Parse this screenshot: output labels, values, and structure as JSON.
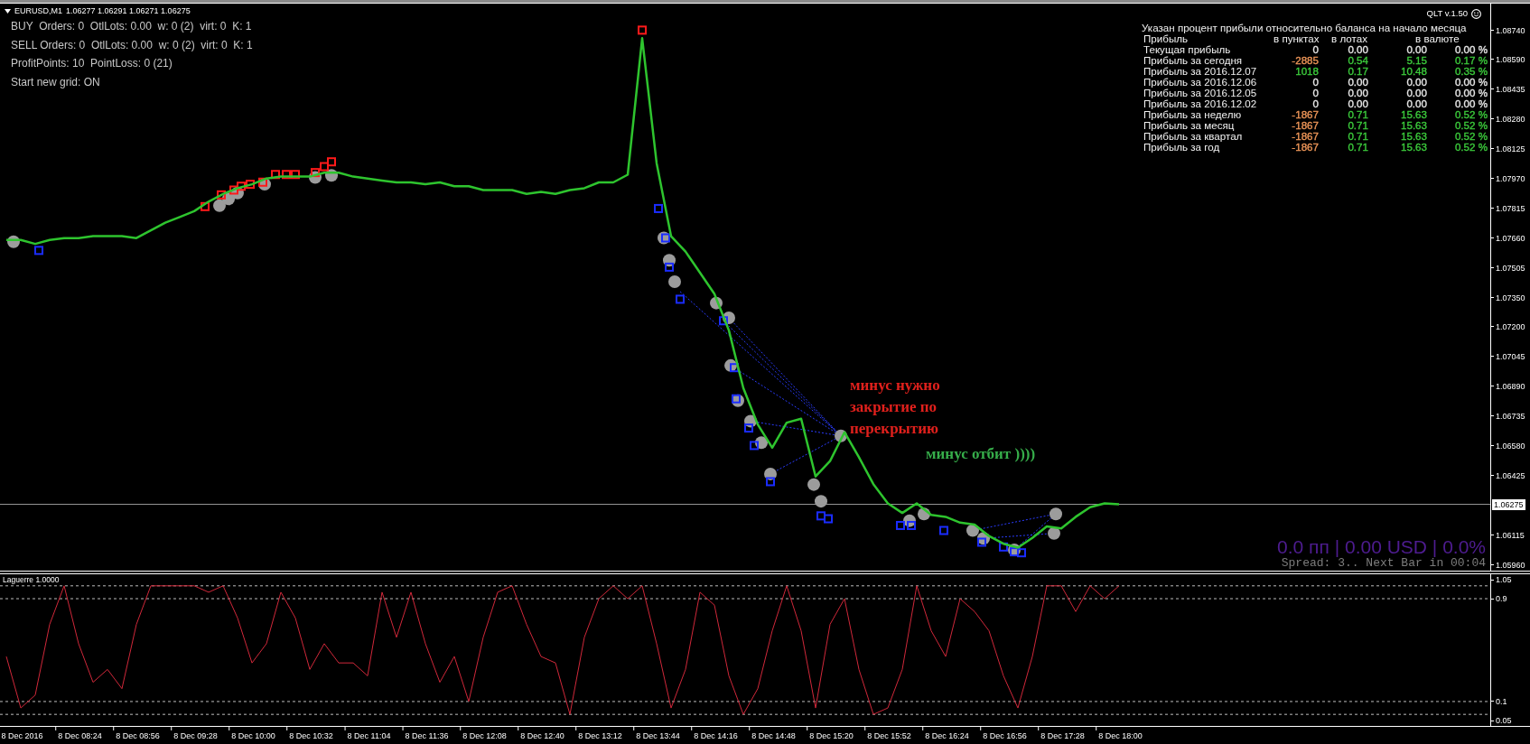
{
  "header": {
    "quote": "1.06277 1.06291 1.06271 1.06275"
  },
  "status_lines": [
    "BUY  Orders: 0  OtlLots: 0.00  w: 0 (2)  virt: 0  K: 1",
    "SELL Orders: 0  OtlLots: 0.00  w: 0 (2)  virt: 0  K: 1",
    "ProfitPoints: 10  PointLoss: 0 (21)",
    "Start new grid: ON"
  ],
  "version": {
    "label": "QLT v.1.50"
  },
  "profit_table": {
    "title": "Указан процент прибыли относительно баланса на начало месяца",
    "label_header": "Прибыль",
    "columns": [
      "в пунктах",
      "в лотах",
      "в валюте"
    ],
    "rows": [
      {
        "label": "Текущая прибыль",
        "cells": [
          {
            "text": "0",
            "color": "#e6e6e6"
          },
          {
            "text": "0.00",
            "color": "#e6e6e6"
          },
          {
            "text": "0.00",
            "color": "#e6e6e6"
          },
          {
            "text": "0.00 %",
            "color": "#e6e6e6"
          }
        ]
      },
      {
        "label": "Прибыль за сегодня",
        "cells": [
          {
            "text": "-2885",
            "color": "#ee9658"
          },
          {
            "text": "0.54",
            "color": "#3ccc3c"
          },
          {
            "text": "5.15",
            "color": "#3ccc3c"
          },
          {
            "text": "0.17 %",
            "color": "#3ccc3c"
          }
        ]
      },
      {
        "label": "Прибыль за 2016.12.07",
        "cells": [
          {
            "text": "1018",
            "color": "#3ccc3c"
          },
          {
            "text": "0.17",
            "color": "#3ccc3c"
          },
          {
            "text": "10.48",
            "color": "#3ccc3c"
          },
          {
            "text": "0.35 %",
            "color": "#3ccc3c"
          }
        ]
      },
      {
        "label": "Прибыль за 2016.12.06",
        "cells": [
          {
            "text": "0",
            "color": "#e6e6e6"
          },
          {
            "text": "0.00",
            "color": "#e6e6e6"
          },
          {
            "text": "0.00",
            "color": "#e6e6e6"
          },
          {
            "text": "0.00 %",
            "color": "#e6e6e6"
          }
        ]
      },
      {
        "label": "Прибыль за 2016.12.05",
        "cells": [
          {
            "text": "0",
            "color": "#e6e6e6"
          },
          {
            "text": "0.00",
            "color": "#e6e6e6"
          },
          {
            "text": "0.00",
            "color": "#e6e6e6"
          },
          {
            "text": "0.00 %",
            "color": "#e6e6e6"
          }
        ]
      },
      {
        "label": "Прибыль за 2016.12.02",
        "cells": [
          {
            "text": "0",
            "color": "#e6e6e6"
          },
          {
            "text": "0.00",
            "color": "#e6e6e6"
          },
          {
            "text": "0.00",
            "color": "#e6e6e6"
          },
          {
            "text": "0.00 %",
            "color": "#e6e6e6"
          }
        ]
      },
      {
        "label": "Прибыль за неделю",
        "cells": [
          {
            "text": "-1867",
            "color": "#ee9658"
          },
          {
            "text": "0.71",
            "color": "#3ccc3c"
          },
          {
            "text": "15.63",
            "color": "#3ccc3c"
          },
          {
            "text": "0.52 %",
            "color": "#3ccc3c"
          }
        ]
      },
      {
        "label": "Прибыль за месяц",
        "cells": [
          {
            "text": "-1867",
            "color": "#ee9658"
          },
          {
            "text": "0.71",
            "color": "#3ccc3c"
          },
          {
            "text": "15.63",
            "color": "#3ccc3c"
          },
          {
            "text": "0.52 %",
            "color": "#3ccc3c"
          }
        ]
      },
      {
        "label": "Прибыль за квартал",
        "cells": [
          {
            "text": "-1867",
            "color": "#ee9658"
          },
          {
            "text": "0.71",
            "color": "#3ccc3c"
          },
          {
            "text": "15.63",
            "color": "#3ccc3c"
          },
          {
            "text": "0.52 %",
            "color": "#3ccc3c"
          }
        ]
      },
      {
        "label": "Прибыль за год",
        "cells": [
          {
            "text": "-1867",
            "color": "#ee9658"
          },
          {
            "text": "0.71",
            "color": "#3ccc3c"
          },
          {
            "text": "15.63",
            "color": "#3ccc3c"
          },
          {
            "text": "0.52 %",
            "color": "#3ccc3c"
          }
        ]
      }
    ]
  },
  "price_chart": {
    "chart_data": {
      "type": "line",
      "categories": [
        null,
        null,
        null,
        null,
        null,
        null,
        null,
        null,
        null,
        null,
        null,
        null,
        null,
        null,
        null,
        null,
        null,
        null,
        null,
        null,
        null,
        null,
        null,
        null,
        null,
        null,
        null,
        null,
        null,
        null,
        null,
        null,
        null,
        null,
        null,
        null,
        null,
        null,
        null,
        null,
        null,
        null,
        null,
        null,
        null,
        null,
        null,
        null,
        null,
        null,
        null,
        null,
        null,
        null,
        null,
        null,
        null,
        null,
        null,
        null,
        null,
        null,
        null,
        null,
        null,
        null,
        null,
        null,
        null,
        null,
        null,
        null,
        null,
        null,
        null,
        null,
        null,
        null,
        null,
        null,
        null,
        null,
        null,
        null,
        null,
        null,
        null,
        null,
        null,
        null,
        null,
        null,
        null,
        null,
        null,
        null,
        null,
        null,
        null,
        null,
        null,
        null,
        null
      ],
      "series": [
        {
          "name": "EURUSD,M1",
          "color": "#2ec42e",
          "values": [
            1.0765,
            1.0765,
            1.0763,
            1.0765,
            1.0766,
            1.0766,
            1.0767,
            1.0767,
            1.0767,
            1.0766,
            1.077,
            1.0774,
            1.0777,
            1.078,
            1.0785,
            1.0789,
            1.0792,
            1.0794,
            1.0797,
            1.0798,
            1.0798,
            1.0798,
            1.08,
            1.08,
            1.0798,
            1.0797,
            1.0796,
            1.0795,
            1.0795,
            1.0794,
            1.0795,
            1.0793,
            1.0793,
            1.0791,
            1.0791,
            1.0791,
            1.0789,
            1.079,
            1.0789,
            1.0791,
            1.0792,
            1.0795,
            1.0795,
            1.0799,
            1.087,
            1.0805,
            1.0767,
            1.0759,
            1.0748,
            1.0737,
            1.0718,
            1.0688,
            1.0669,
            1.0657,
            1.067,
            1.0672,
            1.0642,
            1.065,
            1.0665,
            1.0652,
            1.0638,
            1.0628,
            1.0623,
            1.0628,
            1.0622,
            1.0621,
            1.0618,
            1.0617,
            1.0611,
            1.0607,
            1.0605,
            1.061,
            1.0616,
            1.0615,
            1.0621,
            1.0626,
            1.0628,
            1.06275,
            null,
            null,
            null,
            null,
            null,
            null,
            null,
            null,
            null,
            null,
            null,
            null,
            null,
            null,
            null,
            null,
            null,
            null,
            null,
            null,
            null,
            null,
            null,
            null,
            null
          ]
        }
      ],
      "ylim": [
        1.0593,
        1.0888
      ],
      "yticks": [
        {
          "value": 1.0874,
          "label": "1.08740"
        },
        {
          "value": 1.0859,
          "label": "1.08590"
        },
        {
          "value": 1.08435,
          "label": "1.08435"
        },
        {
          "value": 1.0828,
          "label": "1.08280"
        },
        {
          "value": 1.08125,
          "label": "1.08125"
        },
        {
          "value": 1.0797,
          "label": "1.07970"
        },
        {
          "value": 1.07815,
          "label": "1.07815"
        },
        {
          "value": 1.0766,
          "label": "1.07660"
        },
        {
          "value": 1.07505,
          "label": "1.07505"
        },
        {
          "value": 1.0735,
          "label": "1.07350"
        },
        {
          "value": 1.072,
          "label": "1.07200"
        },
        {
          "value": 1.07045,
          "label": "1.07045"
        },
        {
          "value": 1.0689,
          "label": "1.06890"
        },
        {
          "value": 1.06735,
          "label": "1.06735"
        },
        {
          "value": 1.0658,
          "label": "1.06580"
        },
        {
          "value": 1.06425,
          "label": "1.06425"
        },
        {
          "value": 1.06115,
          "label": "1.06115"
        },
        {
          "value": 1.0596,
          "label": "1.05960"
        }
      ],
      "ref_lines": [
        {
          "axis": "y",
          "value": 1.06275,
          "label": "1.06275"
        }
      ]
    }
  },
  "notes": [
    {
      "color": "#e0201c",
      "lines": [
        "минус нужно",
        "закрытие по",
        "перекрытию"
      ]
    },
    {
      "color": "#36ad4a",
      "lines": [
        "минус отбит ))))"
      ]
    }
  ],
  "account_summary": {
    "result": "0.0 пп | 0.00 USD | 0.0%",
    "timer": "Spread: 3.. Next Bar in 00:04"
  },
  "indicator": {
    "chart_data": {
      "type": "line",
      "categories": [
        null,
        "8 Dec 2016",
        null,
        null,
        null,
        "8 Dec 08:24",
        null,
        null,
        null,
        "8 Dec 08:56",
        null,
        null,
        null,
        "8 Dec 09:28",
        null,
        null,
        null,
        "8 Dec 10:00",
        null,
        null,
        null,
        "8 Dec 10:32",
        null,
        null,
        null,
        "8 Dec 11:04",
        null,
        null,
        null,
        "8 Dec 11:36",
        null,
        null,
        null,
        "8 Dec 12:08",
        null,
        null,
        null,
        "8 Dec 12:40",
        null,
        null,
        null,
        "8 Dec 13:12",
        null,
        null,
        null,
        "8 Dec 13:44",
        null,
        null,
        null,
        "8 Dec 14:16",
        null,
        null,
        null,
        "8 Dec 14:48",
        null,
        null,
        null,
        "8 Dec 15:20",
        null,
        null,
        null,
        "8 Dec 15:52",
        null,
        null,
        null,
        "8 Dec 16:24",
        null,
        null,
        null,
        "8 Dec 16:56",
        null,
        null,
        null,
        "8 Dec 17:28",
        null,
        null,
        null,
        "8 Dec 18:00",
        null,
        null,
        null,
        null,
        null,
        null,
        null,
        null,
        null,
        null,
        null,
        null,
        null,
        null,
        null,
        null,
        null,
        null,
        null,
        null,
        null,
        null,
        null,
        null,
        null
      ],
      "series": [
        {
          "name": "Laguerre 1.0000",
          "color": "#d0283a",
          "values": [
            0.45,
            0.05,
            0.15,
            0.7,
            1,
            0.55,
            0.25,
            0.35,
            0.2,
            0.7,
            1,
            1,
            1,
            1,
            0.95,
            1,
            0.75,
            0.4,
            0.55,
            0.95,
            0.75,
            0.35,
            0.55,
            0.4,
            0.4,
            0.3,
            0.95,
            0.6,
            0.95,
            0.55,
            0.25,
            0.45,
            0.1,
            0.6,
            0.95,
            1,
            0.7,
            0.45,
            0.4,
            0,
            0.6,
            0.9,
            1,
            0.9,
            1,
            0.55,
            0.05,
            0.35,
            0.95,
            0.85,
            0.3,
            0,
            0.2,
            0.65,
            1,
            0.65,
            0.05,
            0.7,
            0.9,
            0.35,
            0,
            0.05,
            0.35,
            1,
            0.65,
            0.45,
            0.9,
            0.8,
            0.65,
            0.3,
            0.05,
            0.45,
            1,
            1,
            0.8,
            1,
            0.9,
            1,
            null,
            null,
            null,
            null,
            null,
            null,
            null,
            null,
            null,
            null,
            null,
            null,
            null,
            null,
            null,
            null,
            null,
            null,
            null,
            null,
            null,
            null,
            null,
            null,
            null
          ]
        }
      ],
      "ylim": [
        -0.09,
        1.09
      ],
      "yticks": [
        {
          "value": 1.05,
          "label": "1.05"
        },
        {
          "value": 0.9,
          "label": "0.9"
        },
        {
          "value": 0.1,
          "label": "0.1"
        },
        {
          "value": -0.05,
          "label": "0.05"
        }
      ],
      "ref_lines": [
        {
          "axis": "y",
          "value": 1
        },
        {
          "axis": "y",
          "value": 0.9
        },
        {
          "axis": "y",
          "value": 0.1
        },
        {
          "axis": "y",
          "value": 0
        }
      ]
    }
  }
}
